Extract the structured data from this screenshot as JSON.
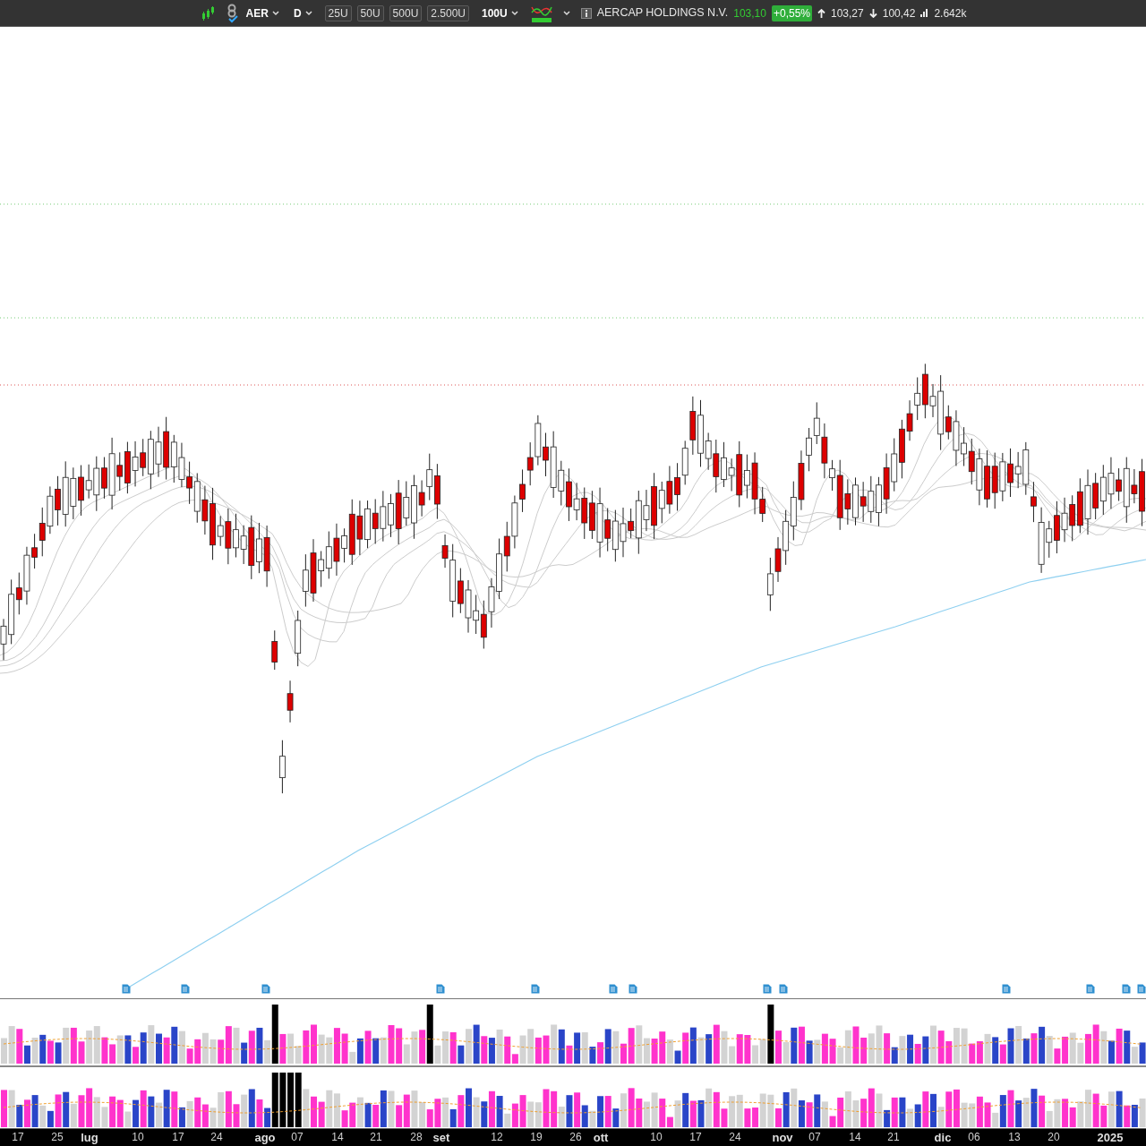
{
  "toolbar": {
    "symbol": "AER",
    "timeframe": "D",
    "size_buttons": [
      "25U",
      "50U",
      "500U",
      "2.500U"
    ],
    "quantity": "100U",
    "instrument_name": "AERCAP HOLDINGS N.V.",
    "last_price": "103,10",
    "change": "+0,55%",
    "high": "103,27",
    "low": "100,42",
    "volume": "2.642k"
  },
  "x_axis": [
    {
      "label": "17",
      "kind": "day"
    },
    {
      "label": "25",
      "kind": "day"
    },
    {
      "label": "lug",
      "kind": "month"
    },
    {
      "label": "10",
      "kind": "day"
    },
    {
      "label": "17",
      "kind": "day"
    },
    {
      "label": "24",
      "kind": "day"
    },
    {
      "label": "ago",
      "kind": "month"
    },
    {
      "label": "07",
      "kind": "day"
    },
    {
      "label": "14",
      "kind": "day"
    },
    {
      "label": "21",
      "kind": "day"
    },
    {
      "label": "28",
      "kind": "day"
    },
    {
      "label": "set",
      "kind": "month"
    },
    {
      "label": "12",
      "kind": "day"
    },
    {
      "label": "19",
      "kind": "day"
    },
    {
      "label": "26",
      "kind": "day"
    },
    {
      "label": "ott",
      "kind": "month"
    },
    {
      "label": "10",
      "kind": "day"
    },
    {
      "label": "17",
      "kind": "day"
    },
    {
      "label": "24",
      "kind": "day"
    },
    {
      "label": "nov",
      "kind": "month"
    },
    {
      "label": "07",
      "kind": "day"
    },
    {
      "label": "14",
      "kind": "day"
    },
    {
      "label": "21",
      "kind": "day"
    },
    {
      "label": "dic",
      "kind": "month"
    },
    {
      "label": "06",
      "kind": "day"
    },
    {
      "label": "13",
      "kind": "day"
    },
    {
      "label": "20",
      "kind": "day"
    },
    {
      "label": "2025",
      "kind": "month"
    }
  ]
}
